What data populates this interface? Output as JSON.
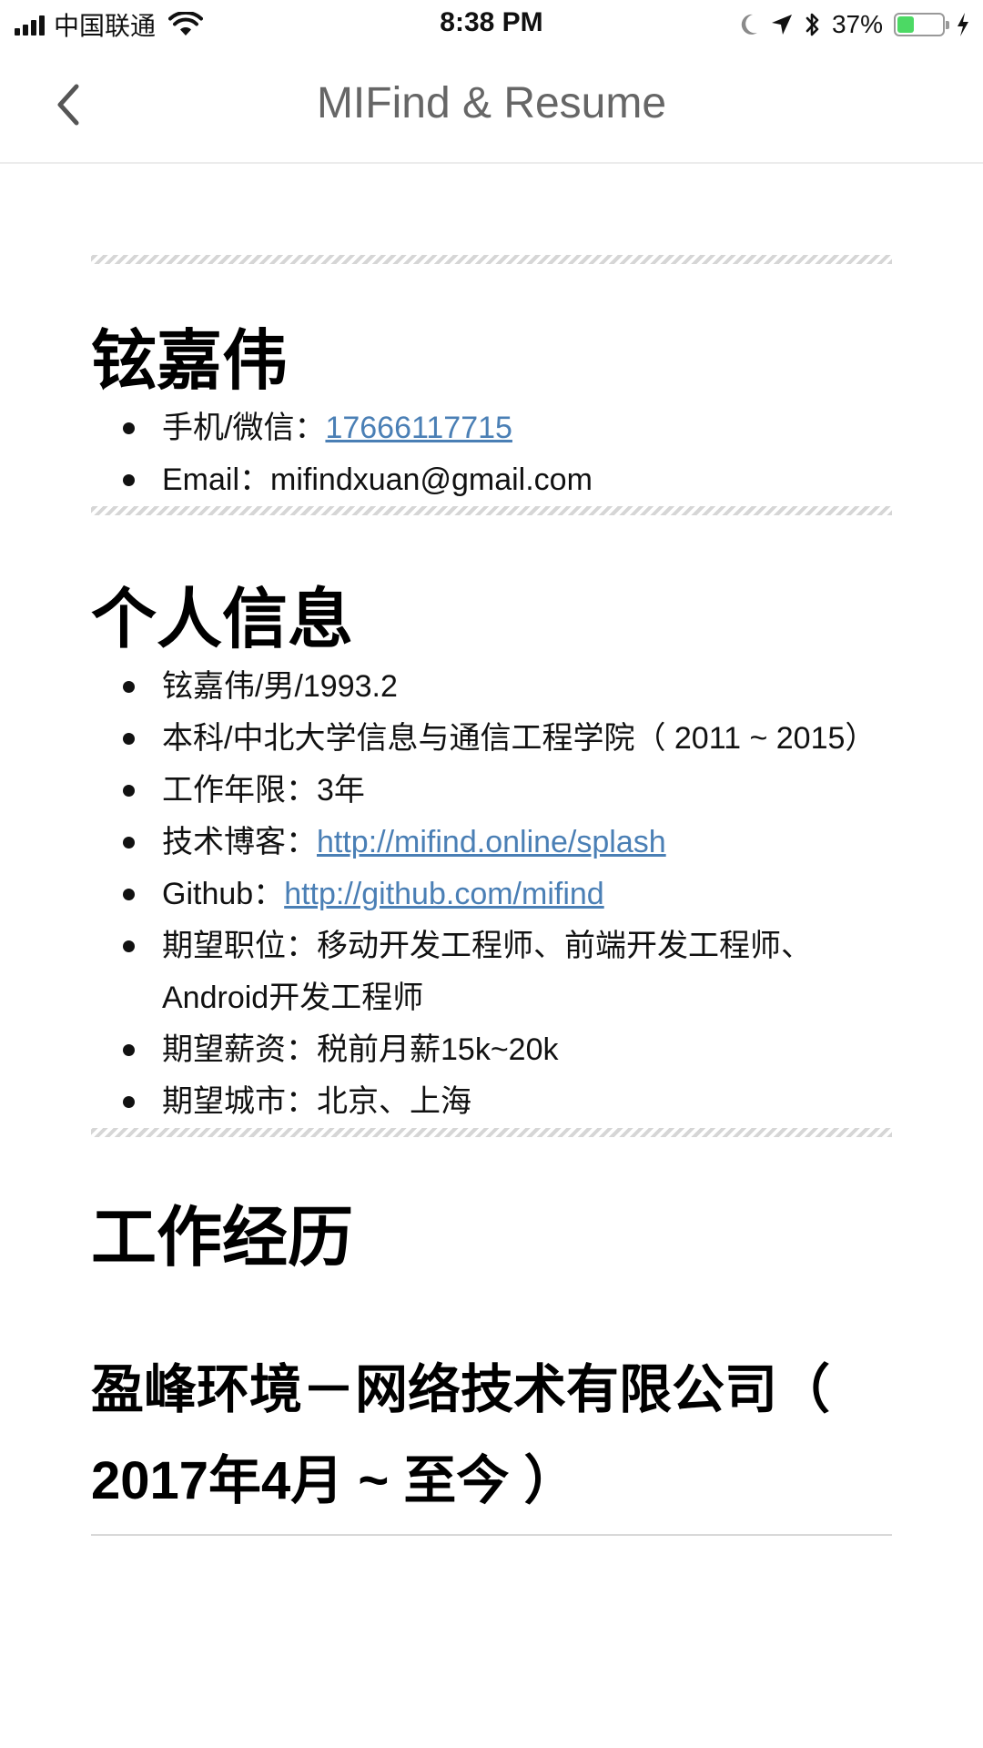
{
  "status_bar": {
    "carrier": "中国联通",
    "time": "8:38 PM",
    "battery_percent": "37%",
    "battery_level": 0.37,
    "icons": [
      "signal-icon",
      "wifi-icon",
      "moon-icon",
      "location-arrow-icon",
      "bluetooth-icon",
      "battery-icon",
      "charging-icon"
    ]
  },
  "nav": {
    "title": "MIFind & Resume",
    "back_icon": "chevron-left-icon"
  },
  "sections": {
    "name": {
      "title": "铉嘉伟",
      "phone_label": "手机/微信：",
      "phone_value": "17666117715",
      "email_label": "Email：",
      "email_value": "mifindxuan@gmail.com"
    },
    "personal": {
      "title": "个人信息",
      "basic": "铉嘉伟/男/1993.2",
      "education": "本科/中北大学信息与通信工程学院（ 2011 ~ 2015）",
      "experience_years": "工作年限：3年",
      "blog_label": "技术博客：",
      "blog_url": "http://mifind.online/splash",
      "github_label": "Github：",
      "github_url": "http://github.com/mifind",
      "position": "期望职位：移动开发工程师、前端开发工程师、Android开发工程师",
      "salary": "期望薪资：税前月薪15k~20k",
      "city": "期望城市：北京、上海"
    },
    "work": {
      "title": "工作经历",
      "company": "盈峰环境－网络技术有限公司（ 2017年4月 ~ 至今 ）"
    }
  },
  "colors": {
    "link": "#4a7fb5",
    "nav_title": "#666666",
    "battery": "#4cd964"
  }
}
